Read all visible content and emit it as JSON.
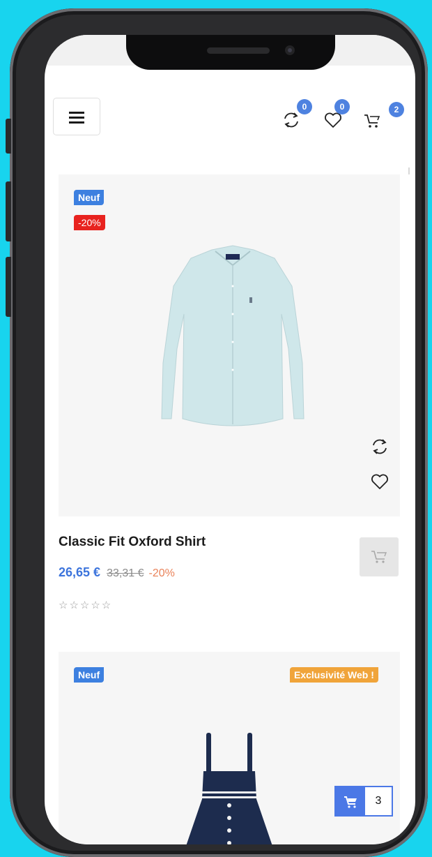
{
  "header": {
    "compare_count": "0",
    "wishlist_count": "0",
    "cart_count": "2",
    "icons": [
      "menu-icon",
      "compare-icon",
      "heart-icon",
      "cart-icon"
    ]
  },
  "products": [
    {
      "tags": {
        "new": "Neuf",
        "discount": "-20%"
      },
      "title": "Classic Fit Oxford Shirt",
      "price": "26,65 €",
      "old_price": "33,31 €",
      "discount": "-20%",
      "stars": "☆☆☆☆☆",
      "rating": 0
    },
    {
      "tags": {
        "new": "Neuf",
        "web": "Exclusivité Web !"
      }
    }
  ],
  "floating_cart": {
    "count": "3"
  },
  "colors": {
    "background": "#18d4ee",
    "accent": "#4e82e0",
    "sale": "#e8231f",
    "web_exclusive": "#f0a43a",
    "price": "#3c74dc"
  }
}
